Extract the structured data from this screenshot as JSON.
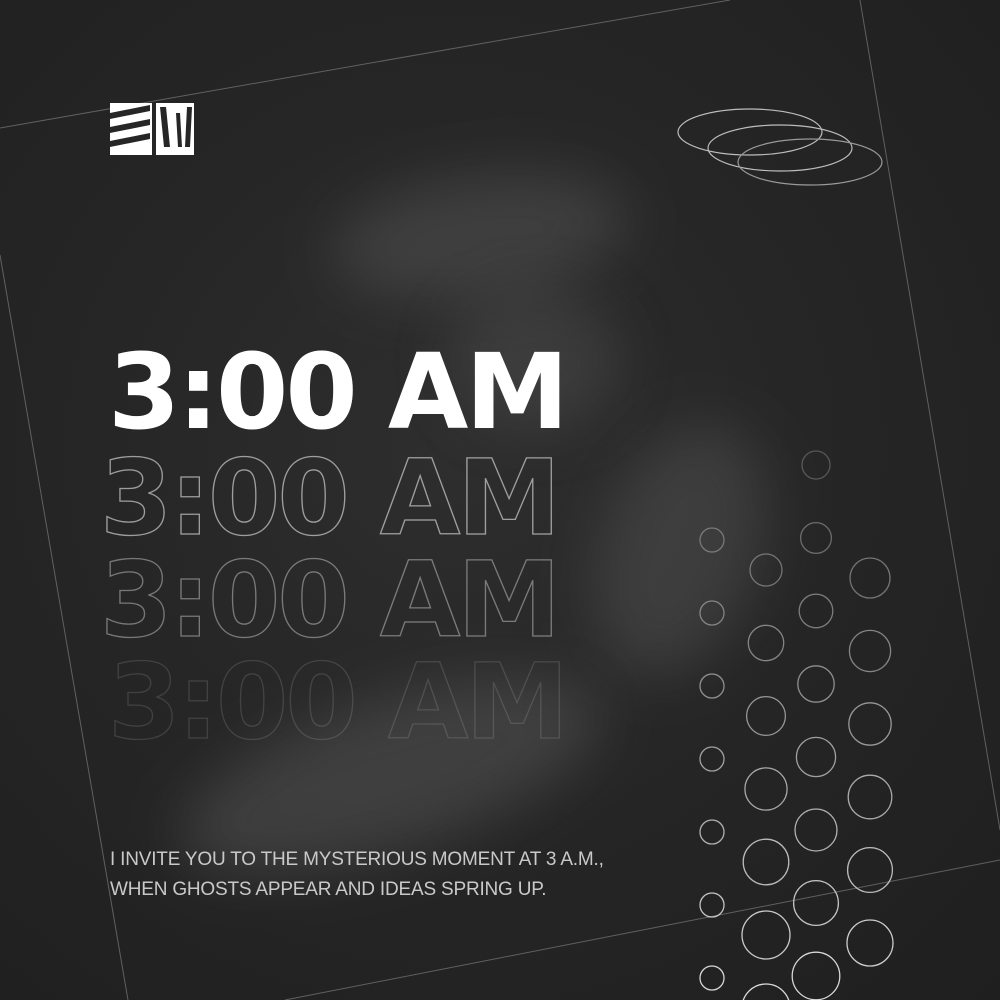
{
  "brand": {
    "logo_text": "SW",
    "logo_icon": "sw-monogram-icon"
  },
  "headline": {
    "text": "3:00 AM",
    "echo_count": 3
  },
  "caption": {
    "line1": "I INVITE YOU TO THE MYSTERIOUS MOMENT AT 3 A.M.,",
    "line2": "WHEN GHOSTS APPEAR AND IDEAS SPRING UP."
  },
  "decor": {
    "ellipses_icon": "orbit-ellipses-icon",
    "dots_icon": "circle-grid-pattern",
    "swirl": "blurred-3-swirl"
  },
  "colors": {
    "background": "#262626",
    "text": "#ffffff",
    "caption": "#c9c9c9",
    "line": "#8a8a8a"
  }
}
